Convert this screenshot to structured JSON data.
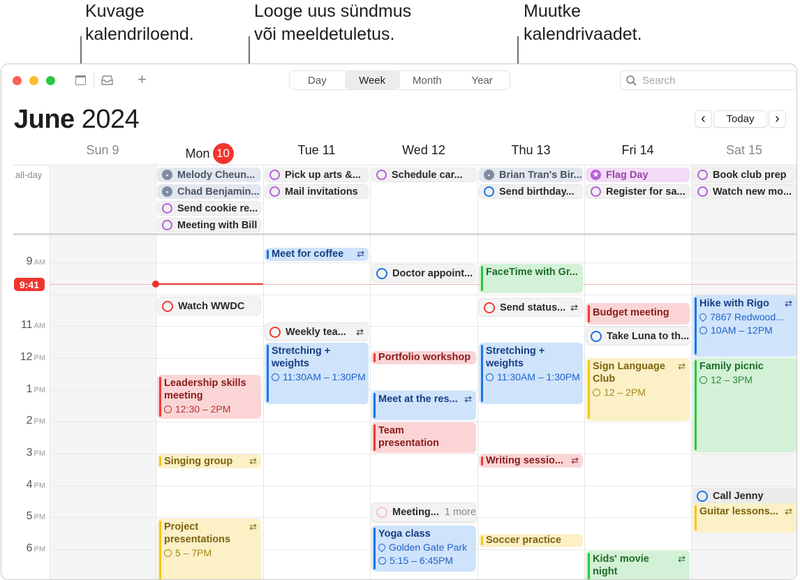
{
  "callouts": [
    {
      "text_line1": "Kuvage",
      "text_line2": "kalendriloend."
    },
    {
      "text_line1": "Looge uus sündmus",
      "text_line2": "või meeldetuletus."
    },
    {
      "text_line1": "Muutke",
      "text_line2": "kalendrivaadet."
    }
  ],
  "toolbar": {
    "views": [
      "Day",
      "Week",
      "Month",
      "Year"
    ],
    "active_view": "Week",
    "search_placeholder": "Search",
    "add_label": "+"
  },
  "header": {
    "month": "June",
    "year": "2024",
    "today_label": "Today",
    "prev_label": "‹",
    "next_label": "›"
  },
  "days": [
    {
      "label": "Sun 9",
      "weekend": true
    },
    {
      "label": "Mon",
      "badge": "10",
      "today": true
    },
    {
      "label": "Tue 11"
    },
    {
      "label": "Wed 12"
    },
    {
      "label": "Thu 13"
    },
    {
      "label": "Fri 14"
    },
    {
      "label": "Sat 15",
      "weekend": true
    }
  ],
  "allday_label": "all-day",
  "allday_events": {
    "mon": [
      "Melody Cheun...",
      "Chad Benjamin...",
      "Send cookie re...",
      "Meeting with Bill"
    ],
    "tue": [
      "Pick up arts &...",
      "Mail invitations"
    ],
    "wed": [
      "Schedule car..."
    ],
    "thu": [
      "Brian Tran's Bir...",
      "Send birthday..."
    ],
    "fri": [
      "Flag Day",
      "Register for sa..."
    ],
    "sat": [
      "Book club prep",
      "Watch new mo..."
    ]
  },
  "hours": [
    {
      "n": "9",
      "p": "AM"
    },
    {
      "n": "11",
      "p": "AM"
    },
    {
      "n": "12",
      "p": "PM"
    },
    {
      "n": "1",
      "p": "PM"
    },
    {
      "n": "2",
      "p": "PM"
    },
    {
      "n": "3",
      "p": "PM"
    },
    {
      "n": "4",
      "p": "PM"
    },
    {
      "n": "5",
      "p": "PM"
    },
    {
      "n": "6",
      "p": "PM"
    }
  ],
  "current_time": "9:41",
  "events": {
    "meet_coffee": "Meet for coffee",
    "watch_wwdc": "Watch WWDC",
    "weekly_team": "Weekly tea...",
    "stretching": "Stretching + weights",
    "stretching_time_a": "11:30AM – 1:30PM",
    "leadership": "Leadership skills meeting",
    "leadership_time": "12:30 – 2PM",
    "singing": "Singing group",
    "project": "Project presentations",
    "project_time": "5 – 7PM",
    "doctor": "Doctor appoint...",
    "portfolio": "Portfolio workshop",
    "meet_res": "Meet at the res...",
    "team_pres": "Team presentation",
    "meeting_more": "Meeting...",
    "more": "1 more",
    "yoga": "Yoga class",
    "yoga_loc": "Golden Gate Park",
    "yoga_time": "5:15 – 6:45PM",
    "facetime": "FaceTime with Gr...",
    "send_status": "Send status...",
    "writing": "Writing sessio...",
    "soccer": "Soccer practice",
    "budget": "Budget meeting",
    "luna": "Take Luna to th...",
    "sign_lang": "Sign Language Club",
    "sign_time": "12 – 2PM",
    "kids_movie": "Kids' movie night",
    "hike": "Hike with Rigo",
    "hike_loc": "7867 Redwood...",
    "hike_time": "10AM – 12PM",
    "picnic": "Family picnic",
    "picnic_time": "12 – 3PM",
    "call_jenny": "Call Jenny",
    "guitar": "Guitar lessons..."
  },
  "colors": {
    "today_red": "#f0352e",
    "event_blue": "#1a73e8",
    "event_red": "#ee3a35",
    "event_green": "#2cc53f",
    "event_yellow": "#f5c518",
    "reminder_purple": "#b65fd8"
  }
}
